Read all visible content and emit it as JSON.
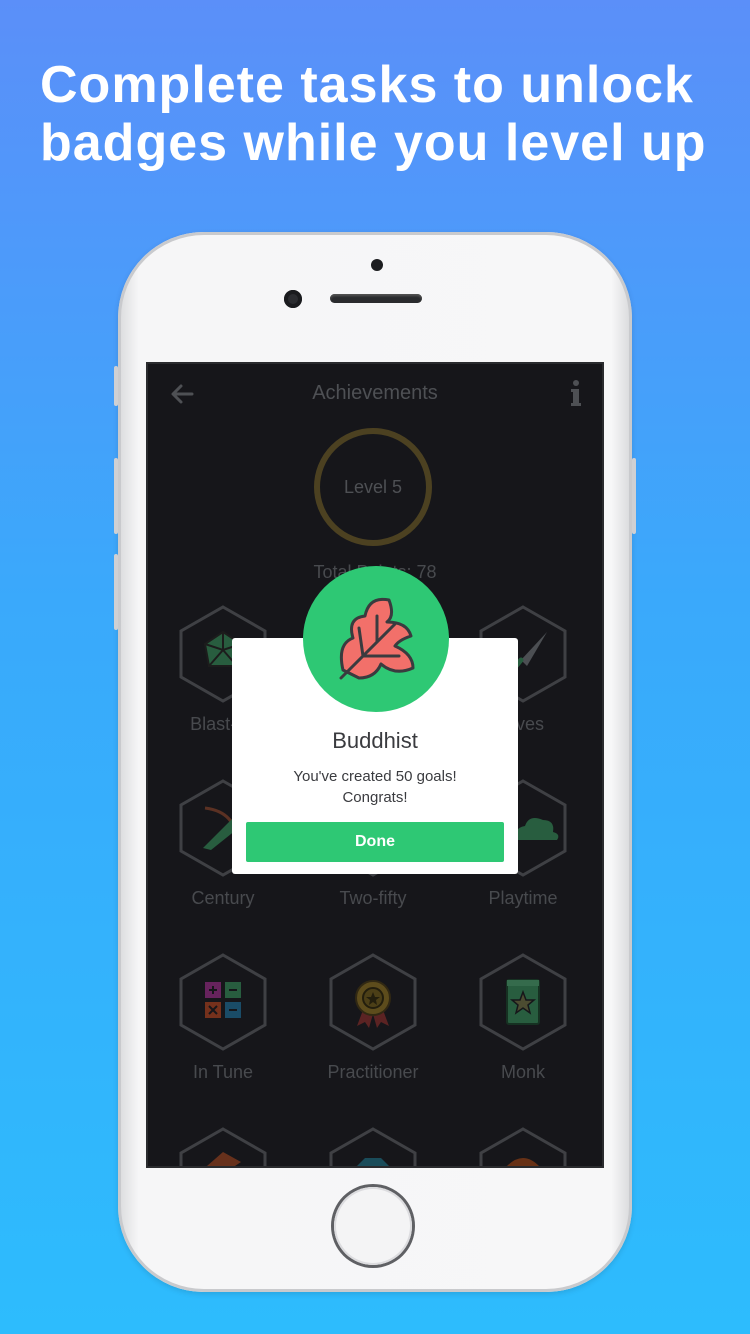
{
  "promo": {
    "headline_line1": "Complete tasks to unlock",
    "headline_line2": "badges while you level up"
  },
  "colors": {
    "background_top": "#5b8ff9",
    "background_bottom": "#2dbcfd",
    "accent_green": "#2ec874",
    "level_ring": "#5a4d27",
    "screen_bg": "#1a1b1f"
  },
  "nav": {
    "title": "Achievements",
    "back_icon": "arrow-left-icon",
    "info_icon": "info-icon"
  },
  "level": {
    "label": "Level 5",
    "total_points": "Total Points: 78"
  },
  "badges": [
    {
      "label": "Blast-off",
      "icon": "d20-die-icon"
    },
    {
      "label": "",
      "icon": "hidden"
    },
    {
      "label": "Lives",
      "icon": "knife-icon"
    },
    {
      "label": "Century",
      "icon": "bow-arrow-icon"
    },
    {
      "label": "Two-fifty",
      "icon": "hidden"
    },
    {
      "label": "Playtime",
      "icon": "cloud-icon"
    },
    {
      "label": "In Tune",
      "icon": "calculator-icon"
    },
    {
      "label": "Practitioner",
      "icon": "medal-icon"
    },
    {
      "label": "Monk",
      "icon": "star-book-icon"
    }
  ],
  "modal": {
    "icon": "leaf-icon",
    "title": "Buddhist",
    "message_line1": "You've created 50 goals!",
    "message_line2": "Congrats!",
    "button_label": "Done"
  }
}
